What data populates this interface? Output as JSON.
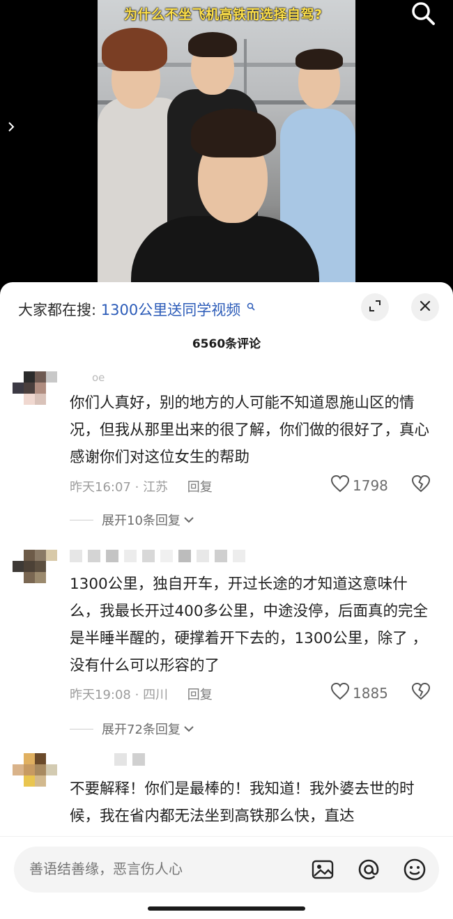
{
  "video": {
    "title": "为什么不坐飞机高铁而选择自驾?",
    "search_icon": "search-icon",
    "nav_icon": "chevron-right-icon"
  },
  "sheet": {
    "search_prefix": "大家都在搜:",
    "search_query": "1300公里送同学视频",
    "comment_count": "6560条评论",
    "expand_icon": "expand-icon",
    "close_icon": "close-icon"
  },
  "comments": [
    {
      "username": "oe",
      "text": "你们人真好，别的地方的人可能不知道恩施山区的情况，但我从那里出来的很了解，你们做的很好了，真心感谢你们对这位女生的帮助",
      "time": "昨天16:07",
      "location": "江苏",
      "reply_label": "回复",
      "likes": "1798",
      "expand_label": "展开10条回复"
    },
    {
      "username": "",
      "text": "1300公里，独自开车，开过长途的才知道这意味什么，我最长开过400多公里，中途没停，后面真的完全是半睡半醒的，硬撑着开下去的，1300公里，除了      ，没有什么可以形容的了",
      "time": "昨天19:08",
      "location": "四川",
      "reply_label": "回复",
      "likes": "1885",
      "expand_label": "展开72条回复"
    },
    {
      "username": "",
      "text": "不要解释！你们是最棒的！我知道！我外婆去世的时候，我在省内都无法坐到高铁那么快，直达"
    }
  ],
  "input_bar": {
    "placeholder": "善语结善缘，恶言伤人心",
    "icons": [
      "image-icon",
      "at-icon",
      "emoji-icon"
    ]
  },
  "colors": {
    "link_blue": "#2b5bb8",
    "title_yellow": "#ffe14a",
    "meta_gray": "#9c9c9c"
  }
}
